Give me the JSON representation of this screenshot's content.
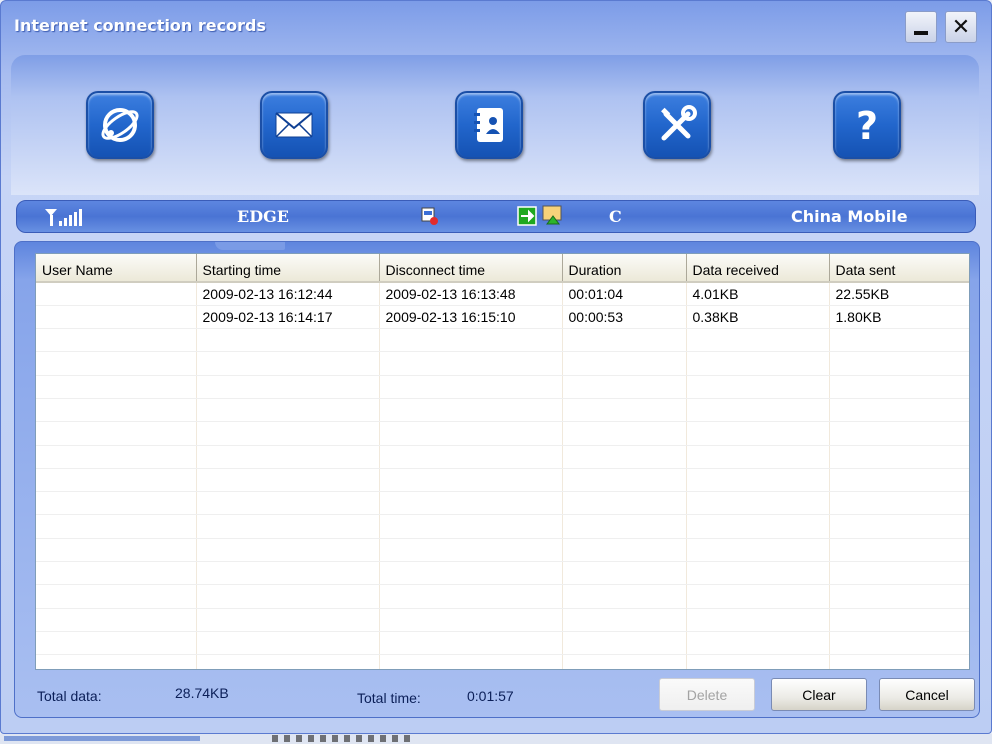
{
  "window": {
    "title": "Internet connection records",
    "minimize_label": "_",
    "close_label": "✕"
  },
  "toolbar": {
    "items": [
      {
        "icon": "internet-globe-icon"
      },
      {
        "icon": "envelope-icon"
      },
      {
        "icon": "contacts-book-icon"
      },
      {
        "icon": "tools-wrench-screwdriver-icon"
      },
      {
        "icon": "help-question-icon"
      }
    ]
  },
  "status": {
    "signal_icon": "signal-strength-icon",
    "network": "EDGE",
    "indicator_a": "sim-card-icon",
    "indicator_b": "connection-arrow-icon",
    "indicator_c": "message-icon",
    "value_c": "C",
    "carrier": "China Mobile"
  },
  "table": {
    "columns": [
      "User Name",
      "Starting time",
      "Disconnect time",
      "Duration",
      "Data received",
      "Data sent"
    ],
    "rows": [
      [
        "",
        "2009-02-13  16:12:44",
        "2009-02-13  16:13:48",
        "00:01:04",
        "4.01KB",
        "22.55KB"
      ],
      [
        "",
        "2009-02-13  16:14:17",
        "2009-02-13  16:15:10",
        "00:00:53",
        "0.38KB",
        "1.80KB"
      ]
    ]
  },
  "footer": {
    "total_data_label": "Total data:",
    "total_data_value": "28.74KB",
    "total_time_label": "Total time:",
    "total_time_value": "0:01:57",
    "delete_label": "Delete",
    "clear_label": "Clear",
    "cancel_label": "Cancel"
  },
  "colors": {
    "accent": "#2266cc",
    "status_bar": "#4a74d4",
    "header_bg": "#ece9d8"
  }
}
